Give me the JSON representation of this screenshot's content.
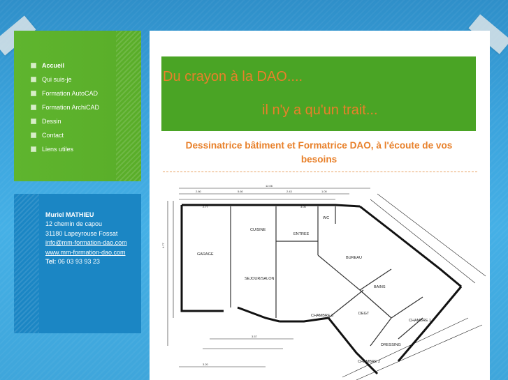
{
  "menu": {
    "items": [
      {
        "label": "Accueil",
        "active": true
      },
      {
        "label": "Qui suis-je",
        "active": false
      },
      {
        "label": "Formation AutoCAD",
        "active": false
      },
      {
        "label": "Formation ArchiCAD",
        "active": false
      },
      {
        "label": "Dessin",
        "active": false
      },
      {
        "label": "Contact",
        "active": false
      },
      {
        "label": "Liens utiles",
        "active": false
      }
    ]
  },
  "contact": {
    "name": "Muriel MATHIEU",
    "address1": "12 chemin de capou",
    "address2": "31180 Lapeyrouse Fossat",
    "email": "info@mm-formation-dao.com",
    "website": "www.mm-formation-dao.com",
    "tel_label": "Tel:",
    "tel_value": "06 03 93 93 23"
  },
  "banner": {
    "line1": "Du crayon à la DAO....",
    "line2": "il n'y a qu'un trait..."
  },
  "subtitle": "Dessinatrice bâtiment et Formatrice DAO, à l'écoute de vos besoins",
  "floor_plan": {
    "rooms": [
      "GARAGE",
      "CUISINE",
      "ENTREE",
      "WC",
      "BUREAU",
      "SEJOUR/SALON",
      "BAINS",
      "CHAMBRE 3",
      "DEGT",
      "CHAMBRE 1",
      "DRESSING",
      "CHAMBRE 2"
    ],
    "dimensions": [
      "12.06",
      "2.80",
      "5.60",
      "2.43",
      "1.00",
      "2.77",
      "3.05",
      "4.77",
      "3.57",
      "3.20"
    ]
  },
  "colors": {
    "menu_green": "#5db22c",
    "contact_blue": "#1b86c4",
    "banner_green": "#4aa425",
    "accent_orange": "#e8802a"
  }
}
